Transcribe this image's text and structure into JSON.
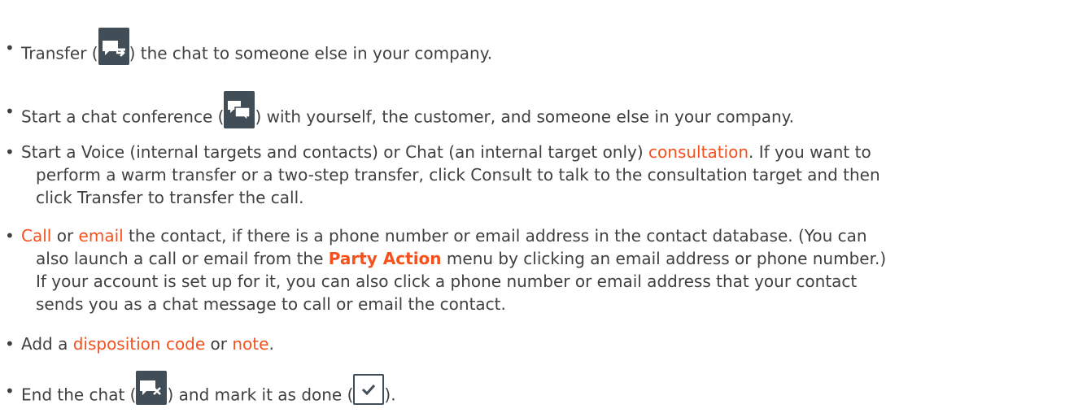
{
  "colors": {
    "text": "#404040",
    "link": "#f4511e",
    "icon_bg": "#414d57"
  },
  "items": [
    {
      "pre": "Transfer (",
      "icon": "transfer-chat-icon",
      "post": ") the chat to someone else in your company."
    },
    {
      "pre": "Start a chat conference (",
      "icon": "chat-conference-icon",
      "post": ") with yourself, the customer, and someone else in your company."
    },
    {
      "line1_pre": "Start a Voice (internal targets and contacts) or Chat (an internal target only) ",
      "line1_link": "consultation",
      "line1_post": ". If you want to",
      "line2": "perform a warm transfer or a two-step transfer, click Consult to talk to the consultation target and then",
      "line3": "click Transfer to transfer the call."
    },
    {
      "link_call": "Call",
      "mid1": " or ",
      "link_email": "email",
      "line1_post": " the contact, if there is a phone number or email address in the contact database. (You can",
      "line2_pre": "also launch a call or email from the ",
      "line2_bold": "Party Action",
      "line2_post": " menu by clicking an email address or phone number.)",
      "line3": "If your account is set up for it, you can also click a phone number or email address that your contact",
      "line4": "sends you as a chat message to call or email the contact."
    },
    {
      "pre": "Add a ",
      "link_disposition": "disposition code",
      "mid": " or ",
      "link_note": "note",
      "post": "."
    },
    {
      "pre": "End the chat (",
      "icon1": "end-chat-icon",
      "mid": ") and mark it as done (",
      "icon2": "mark-done-icon",
      "post": ")."
    }
  ],
  "bullet": "•"
}
